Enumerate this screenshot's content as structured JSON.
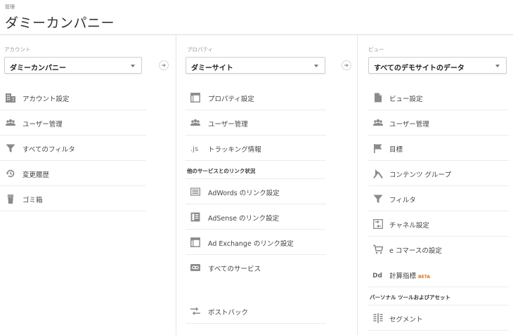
{
  "header": {
    "kicker": "管理",
    "title": "ダミーカンパニー"
  },
  "account": {
    "label": "アカウント",
    "selected": "ダミーカンパニー",
    "items": [
      {
        "label": "アカウント設定",
        "icon": "building-icon"
      },
      {
        "label": "ユーザー管理",
        "icon": "users-icon"
      },
      {
        "label": "すべてのフィルタ",
        "icon": "filter-icon"
      },
      {
        "label": "変更履歴",
        "icon": "history-icon"
      },
      {
        "label": "ゴミ箱",
        "icon": "trash-icon"
      }
    ]
  },
  "property": {
    "label": "プロパティ",
    "selected": "ダミーサイト",
    "items": [
      {
        "label": "プロパティ設定",
        "icon": "window-icon"
      },
      {
        "label": "ユーザー管理",
        "icon": "users-icon"
      },
      {
        "label": "トラッキング情報",
        "icon": "js-icon",
        "glyph": ".js"
      }
    ],
    "section_title": "他のサービスとのリンク状況",
    "links": [
      {
        "label": "AdWords のリンク設定",
        "icon": "adwords-icon"
      },
      {
        "label": "AdSense のリンク設定",
        "icon": "adsense-icon"
      },
      {
        "label": "Ad Exchange のリンク設定",
        "icon": "window-icon"
      },
      {
        "label": "すべてのサービス",
        "icon": "link-icon"
      }
    ],
    "postback": {
      "label": "ポストバック",
      "icon": "postback-icon"
    }
  },
  "view": {
    "label": "ビュー",
    "selected": "すべてのデモサイトのデータ",
    "items": [
      {
        "label": "ビュー設定",
        "icon": "document-icon"
      },
      {
        "label": "ユーザー管理",
        "icon": "users-icon"
      },
      {
        "label": "目標",
        "icon": "flag-icon"
      },
      {
        "label": "コンテンツ グループ",
        "icon": "content-group-icon"
      },
      {
        "label": "フィルタ",
        "icon": "filter-icon"
      },
      {
        "label": "チャネル設定",
        "icon": "channel-icon"
      },
      {
        "label": "e コマースの設定",
        "icon": "cart-icon"
      },
      {
        "label": "計算指標",
        "icon": "dd-icon",
        "glyph": "Dd",
        "badge": "BETA"
      }
    ],
    "section_title": "パーソナル ツールおよびアセット",
    "tools": [
      {
        "label": "セグメント",
        "icon": "segment-icon"
      }
    ]
  }
}
